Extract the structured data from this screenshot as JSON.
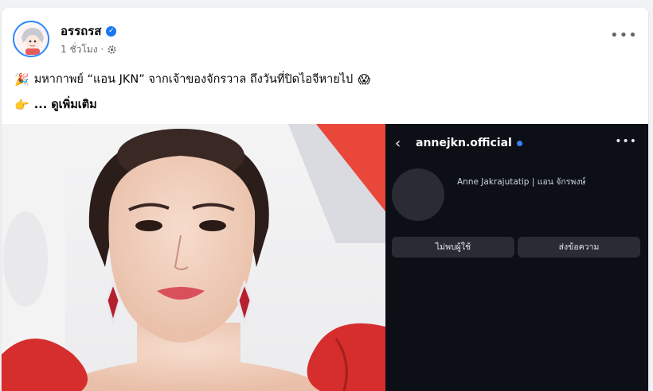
{
  "post": {
    "author": "อรรถรส",
    "time": "1 ชั่วโมง ·",
    "privacy_icon": "gear-icon",
    "line1_emoji": "🎉",
    "line1_text": "มหากาพย์ “แอน JKN” จากเจ้าของจักรวาล ถึงวันที่ปิดไอจีหายไป",
    "line1_end_emoji": "😱",
    "line2_emoji": "👉",
    "line2_text": "... ดูเพิ่มเติม"
  },
  "instagram": {
    "handle": "annejkn.official",
    "name": "Anne Jakrajutatip | แอน จักรพงษ์",
    "buttons": [
      "ไม่พบผู้ใช้",
      "ส่งข้อความ"
    ]
  },
  "colors": {
    "verified": "#1877f2",
    "ig_bg": "#0d0f17",
    "accent_red": "#d62d2d"
  }
}
